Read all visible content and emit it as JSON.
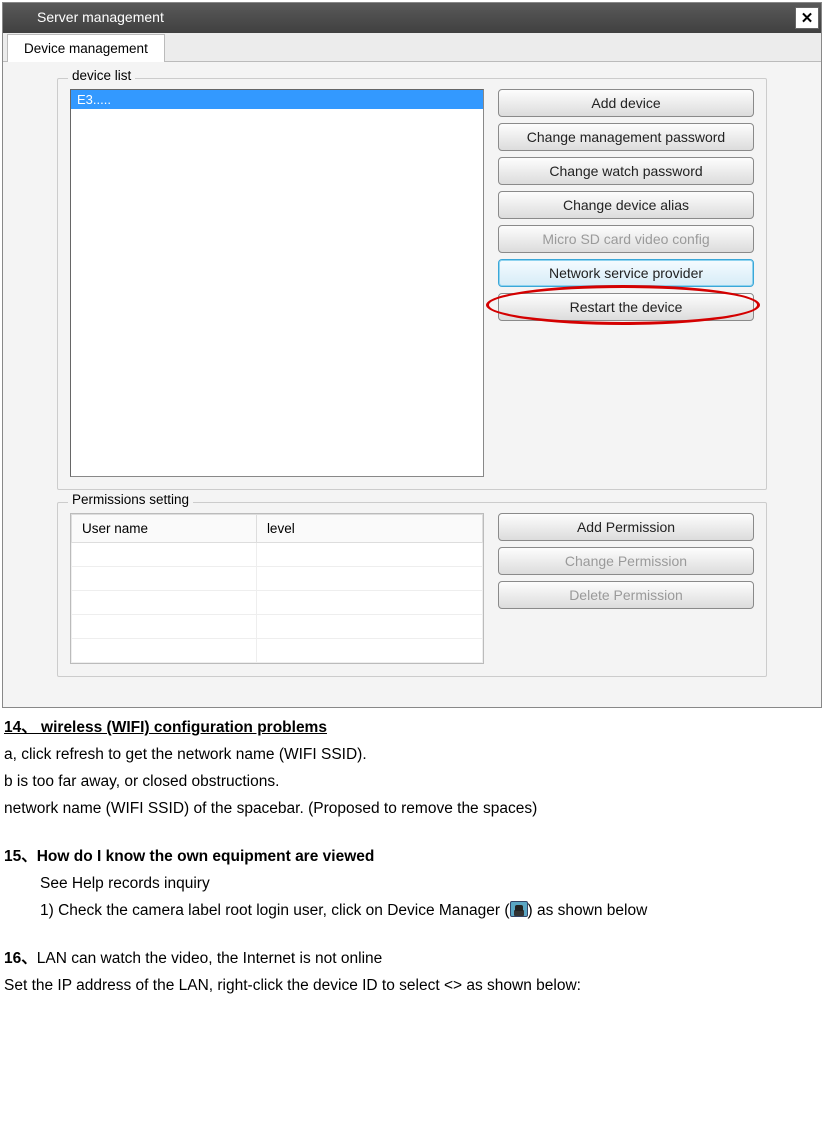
{
  "window": {
    "title": "Server management",
    "tab": "Device management"
  },
  "device_group": {
    "label": "device list",
    "selected_item": "E3.....",
    "buttons": {
      "add": "Add device",
      "change_mgmt_pw": "Change management password",
      "change_watch_pw": "Change watch password",
      "change_alias": "Change device alias",
      "sd_config": "Micro SD card video config",
      "net_provider": "Network service provider",
      "restart": "Restart the device"
    }
  },
  "perm_group": {
    "label": "Permissions setting",
    "cols": {
      "user": "User name",
      "level": "level"
    },
    "buttons": {
      "add": "Add Permission",
      "change": "Change Permission",
      "delete": "Delete Permission"
    }
  },
  "doc": {
    "h14": "14、  wireless (WIFI) configuration problems",
    "p14a": "a, click refresh to get the network name (WIFI SSID).",
    "p14b": "b is too far away, or closed obstructions.",
    "p14c": "network name (WIFI SSID) of the spacebar. (Proposed to remove the spaces)",
    "h15": "15、How do I know the own equipment are viewed",
    "p15a": "See Help records inquiry",
    "p15b_pre": "1) Check the camera label root login user, click on Device Manager (",
    "p15b_post": ") as shown below",
    "h16": "16、LAN can watch the video, the Internet is not online",
    "p16a": "Set the IP address of the LAN, right-click the device ID to select <> as shown below:"
  }
}
